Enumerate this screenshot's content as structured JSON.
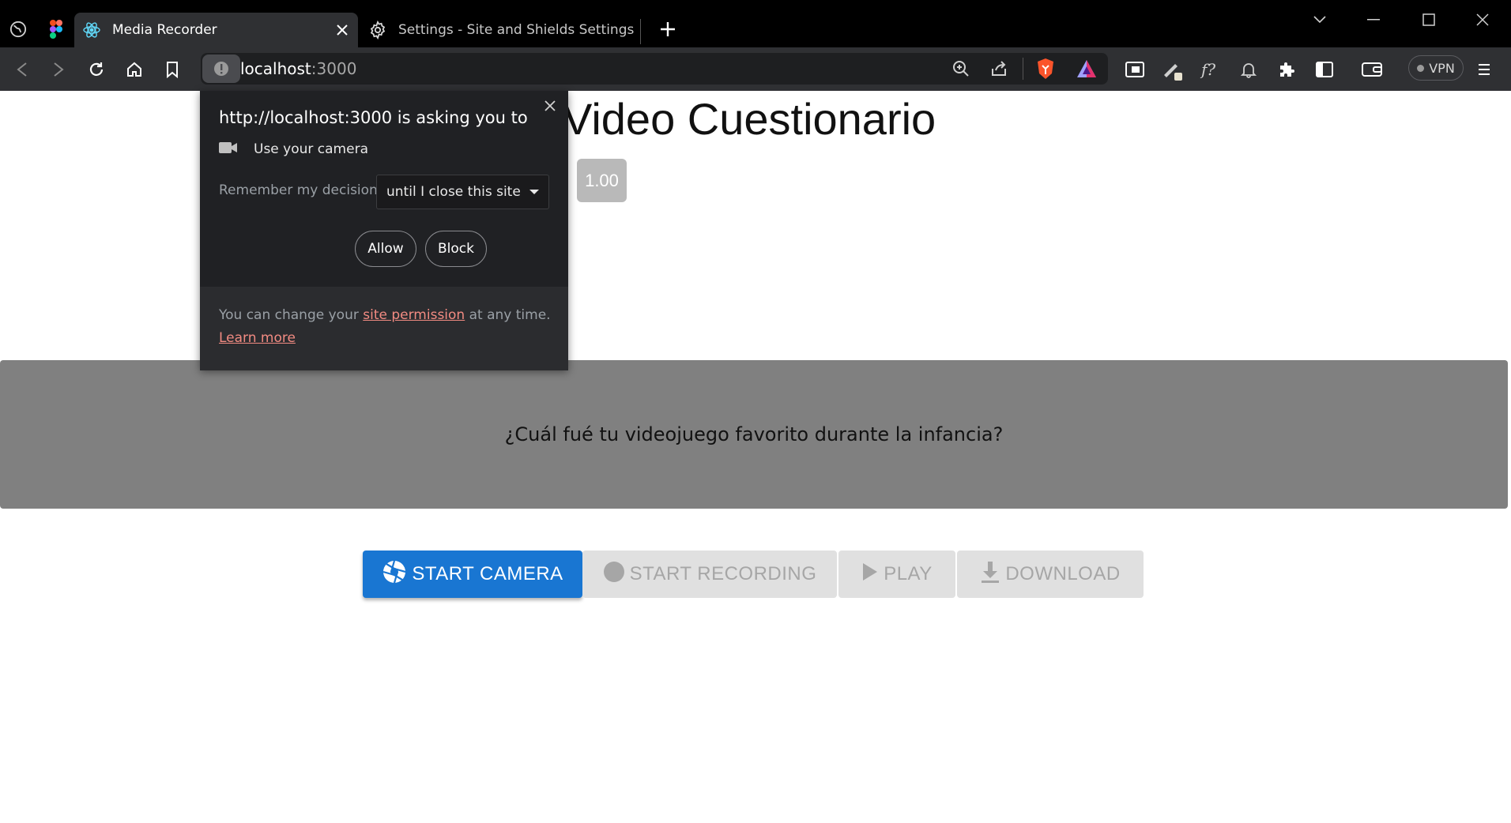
{
  "browser": {
    "tabs": [
      {
        "title": "Media Recorder",
        "active": true,
        "icon": "react-icon"
      },
      {
        "title": "Settings - Site and Shields Settings",
        "active": false,
        "icon": "gear-icon"
      }
    ],
    "pinned_icons": [
      "globe-icon",
      "figma-icon"
    ],
    "url_host": "localhost",
    "url_port": ":3000",
    "vpn_label": "VPN"
  },
  "page": {
    "title": "Video Cuestionario",
    "speed_badge": "1.00",
    "question": "¿Cuál fué tu videojuego favorito durante la infancia?",
    "actions": {
      "start_camera": "START CAMERA",
      "start_recording": "START RECORDING",
      "play": "PLAY",
      "download": "DOWNLOAD"
    }
  },
  "permission_popup": {
    "heading": "http://localhost:3000 is asking you to",
    "permission": "Use your camera",
    "remember_label": "Remember my decision",
    "remember_value": "until I close this site",
    "allow_label": "Allow",
    "block_label": "Block",
    "footer_prefix": "You can change your",
    "footer_link": "site permission",
    "footer_suffix": "at any time.",
    "learn_more": "Learn more"
  },
  "colors": {
    "primary": "#1976d2",
    "question_band": "#808080",
    "link": "#f28b82"
  }
}
